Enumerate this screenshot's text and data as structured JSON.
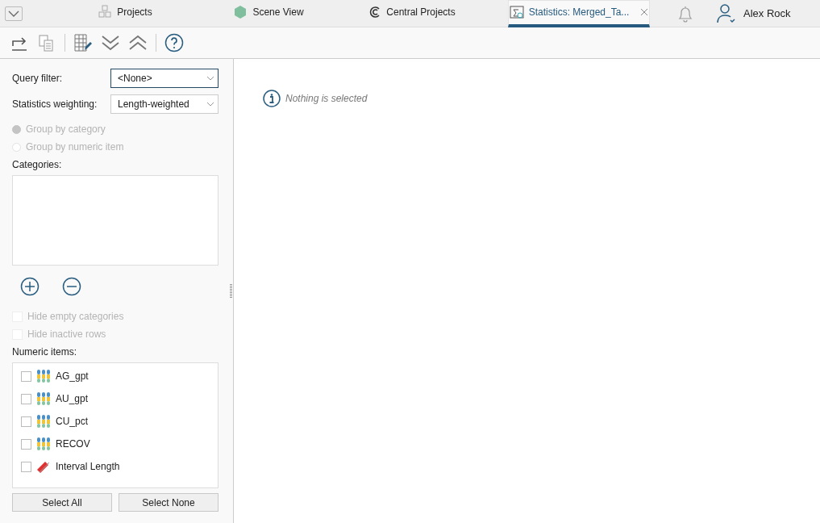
{
  "tabs": [
    {
      "label": "Projects",
      "kind": "projects",
      "selected": false
    },
    {
      "label": "Scene View",
      "kind": "scene",
      "selected": false
    },
    {
      "label": "Central Projects",
      "kind": "central",
      "selected": false
    },
    {
      "label": "Statistics: Merged_Ta...",
      "kind": "stats",
      "selected": true
    }
  ],
  "user": {
    "name": "Alex Rock"
  },
  "form": {
    "query_filter": {
      "label": "Query filter:",
      "value": "<None>"
    },
    "weighting": {
      "label": "Statistics weighting:",
      "value": "Length-weighted"
    },
    "grouping": [
      {
        "label": "Group by category",
        "selected": true
      },
      {
        "label": "Group by numeric item",
        "selected": false
      }
    ],
    "categories_label": "Categories:",
    "options": [
      {
        "label": "Hide empty categories",
        "checked": false
      },
      {
        "label": "Hide inactive rows",
        "checked": false
      }
    ],
    "numeric_label": "Numeric items:",
    "numeric_items": [
      {
        "label": "AG_gpt",
        "kind": "numeric",
        "checked": false
      },
      {
        "label": "AU_gpt",
        "kind": "numeric",
        "checked": false
      },
      {
        "label": "CU_pct",
        "kind": "numeric",
        "checked": false
      },
      {
        "label": "RECOV",
        "kind": "numeric",
        "checked": false
      },
      {
        "label": "Interval Length",
        "kind": "length",
        "checked": false
      }
    ],
    "buttons": [
      "Select All",
      "Select None"
    ]
  },
  "message": "Nothing is selected"
}
